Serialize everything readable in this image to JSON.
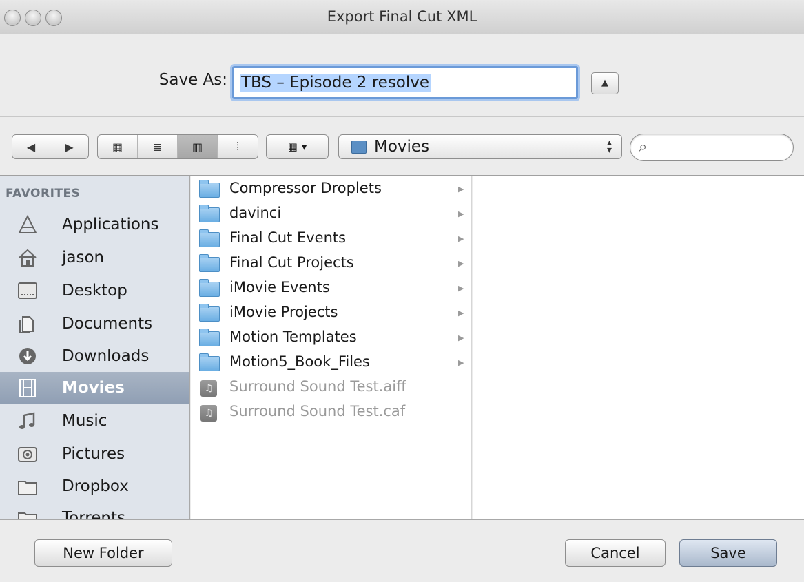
{
  "window": {
    "title": "Export Final Cut XML"
  },
  "save_row": {
    "label": "Save As:",
    "filename": "TBS – Episode 2 resolve",
    "expand_glyph": "▲"
  },
  "toolbar": {
    "back_glyph": "◀",
    "forward_glyph": "▶",
    "view_glyphs": [
      "▦",
      "≣",
      "▥",
      "⦙"
    ],
    "arrange_glyph": "▦",
    "arrange_caret": "▾",
    "location": "Movies",
    "search_placeholder": ""
  },
  "sidebar": {
    "header": "FAVORITES",
    "items": [
      {
        "label": "Applications",
        "icon": "applications-icon"
      },
      {
        "label": "jason",
        "icon": "home-icon"
      },
      {
        "label": "Desktop",
        "icon": "desktop-icon"
      },
      {
        "label": "Documents",
        "icon": "documents-icon"
      },
      {
        "label": "Downloads",
        "icon": "downloads-icon"
      },
      {
        "label": "Movies",
        "icon": "movies-icon",
        "selected": true
      },
      {
        "label": "Music",
        "icon": "music-icon"
      },
      {
        "label": "Pictures",
        "icon": "pictures-icon"
      },
      {
        "label": "Dropbox",
        "icon": "folder-icon"
      },
      {
        "label": "Torrents",
        "icon": "folder-icon"
      }
    ]
  },
  "browser": {
    "files": [
      {
        "name": "Compressor Droplets",
        "kind": "folder"
      },
      {
        "name": "davinci",
        "kind": "folder"
      },
      {
        "name": "Final Cut Events",
        "kind": "folder"
      },
      {
        "name": "Final Cut Projects",
        "kind": "folder"
      },
      {
        "name": "iMovie Events",
        "kind": "folder"
      },
      {
        "name": "iMovie Projects",
        "kind": "folder"
      },
      {
        "name": "Motion Templates",
        "kind": "folder"
      },
      {
        "name": "Motion5_Book_Files",
        "kind": "folder"
      },
      {
        "name": "Surround Sound Test.aiff",
        "kind": "audio",
        "disabled": true
      },
      {
        "name": "Surround Sound Test.caf",
        "kind": "audio",
        "disabled": true
      }
    ],
    "disclosure_glyph": "▶",
    "audio_glyph": "♫"
  },
  "buttons": {
    "new_folder": "New Folder",
    "cancel": "Cancel",
    "save": "Save"
  },
  "colors": {
    "sidebar_bg": "#dfe4eb",
    "selection": "#9aa8bb",
    "field_focus": "#6b9ad8",
    "text_selection": "#b5d5ff"
  }
}
